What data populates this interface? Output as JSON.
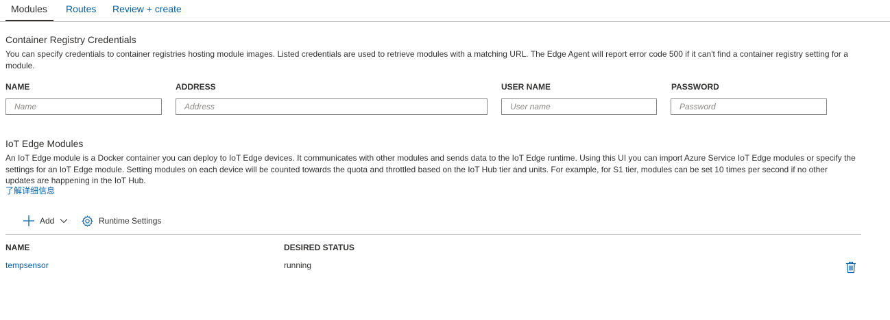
{
  "tabs": [
    {
      "label": "Modules",
      "active": true
    },
    {
      "label": "Routes",
      "active": false
    },
    {
      "label": "Review + create",
      "active": false
    }
  ],
  "registry": {
    "title": "Container Registry Credentials",
    "description": "You can specify credentials to container registries hosting module images. Listed credentials are used to retrieve modules with a matching URL. The Edge Agent will report error code 500 if it can't find a container registry setting for a module.",
    "columns": {
      "name": {
        "label": "NAME",
        "placeholder": "Name",
        "value": ""
      },
      "address": {
        "label": "ADDRESS",
        "placeholder": "Address",
        "value": ""
      },
      "username": {
        "label": "USER NAME",
        "placeholder": "User name",
        "value": ""
      },
      "password": {
        "label": "PASSWORD",
        "placeholder": "Password",
        "value": ""
      }
    }
  },
  "modules": {
    "title": "IoT Edge Modules",
    "description": "An IoT Edge module is a Docker container you can deploy to IoT Edge devices. It communicates with other modules and sends data to the IoT Edge runtime. Using this UI you can import Azure Service IoT Edge modules or specify the settings for an IoT Edge module. Setting modules on each device will be counted towards the quota and throttled based on the IoT Hub tier and units. For example, for S1 tier, modules can be set 10 times per second if no other updates are happening in the IoT Hub.",
    "learn_more": "了解详细信息",
    "toolbar": {
      "add_label": "Add",
      "runtime_label": "Runtime Settings"
    },
    "grid": {
      "headers": {
        "name": "NAME",
        "status": "DESIRED STATUS"
      },
      "rows": [
        {
          "name": "tempsensor",
          "status": "running"
        }
      ]
    }
  },
  "icons": {
    "add": "plus-icon",
    "add_menu": "chevron-down-icon",
    "runtime": "gear-icon",
    "delete": "trash-icon"
  },
  "colors": {
    "link": "#0062ad",
    "text": "#323130",
    "input_border": "#8a8886",
    "divider": "#c8c6c4"
  }
}
